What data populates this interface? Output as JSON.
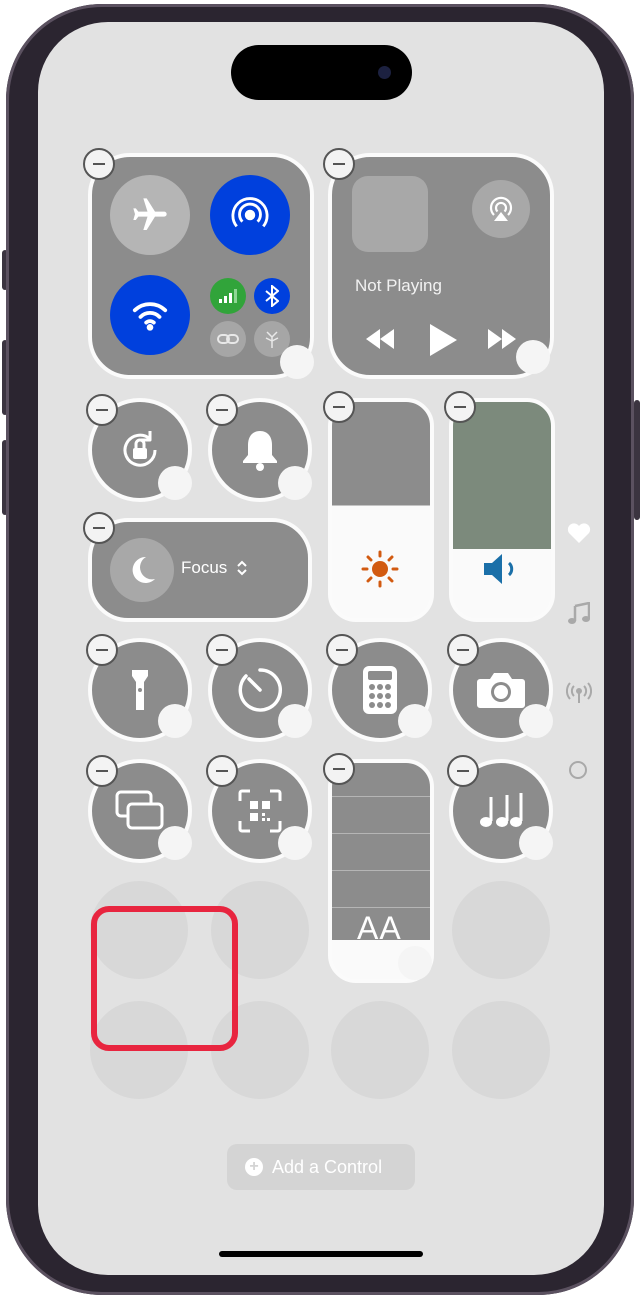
{
  "media": {
    "status": "Not Playing"
  },
  "focus": {
    "label": "Focus",
    "chevron": "⌃⌄"
  },
  "text_size": {
    "label": "AA"
  },
  "add_control": {
    "label": "Add a Control",
    "plus": "+"
  },
  "side_indicators": [
    "heart-icon",
    "music-note-icon",
    "antenna-icon",
    "circle-icon"
  ],
  "colors": {
    "accent": "#0040dd",
    "cellular": "#31a43a",
    "highlight": "#e8253f",
    "brightness": "#d25a10",
    "volume": "#1a6fa8"
  }
}
